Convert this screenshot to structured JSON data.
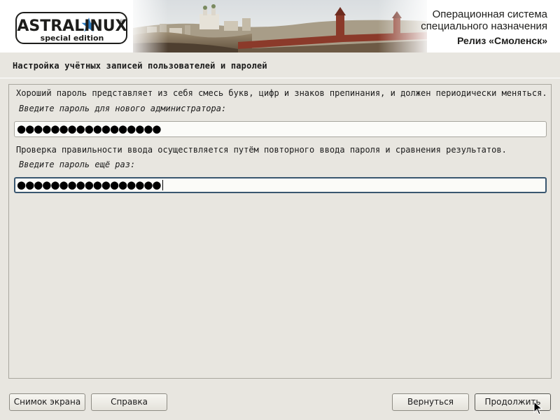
{
  "branding": {
    "logo_text": "ASTRALINUX",
    "logo_reg": "®",
    "logo_subtitle": "special edition",
    "product_line1": "Операционная система",
    "product_line2": "специального назначения",
    "release": "Релиз «Смоленск»"
  },
  "page_title": "Настройка учётных записей пользователей и паролей",
  "content": {
    "intro_text": "Хороший пароль представляет из себя смесь букв, цифр и знаков препинания, и должен периодически меняться.",
    "password_prompt": "Введите пароль для нового администратора:",
    "password_value": "●●●●●●●●●●●●●●●●●",
    "verify_text": "Проверка правильности ввода осуществляется путём повторного ввода пароля и сравнения результатов.",
    "verify_prompt": "Введите пароль ещё раз:",
    "verify_value": "●●●●●●●●●●●●●●●●●"
  },
  "buttons": {
    "screenshot": "Снимок экрана",
    "help": "Справка",
    "back": "Вернуться",
    "continue": "Продолжить"
  },
  "colors": {
    "background": "#e8e6e0",
    "logo_star": "#2b7bc0",
    "focus_border": "#3a5770"
  }
}
